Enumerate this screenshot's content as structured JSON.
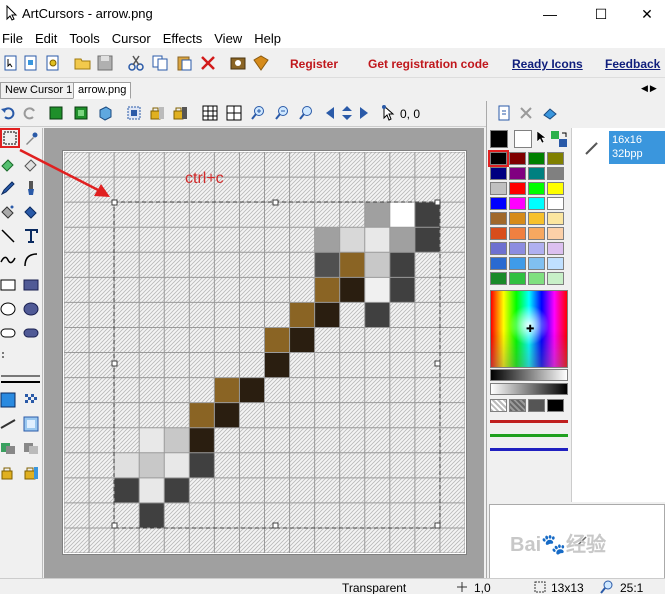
{
  "window": {
    "title": "ArtCursors - arrow.png"
  },
  "menu": [
    "File",
    "Edit",
    "Tools",
    "Cursor",
    "Effects",
    "View",
    "Help"
  ],
  "toolbar": {
    "register": "Register",
    "get_code": "Get registration code",
    "ready_icons": "Ready Icons",
    "feedback": "Feedback"
  },
  "tabs": [
    {
      "label": "New Cursor 1",
      "active": false
    },
    {
      "label": "arrow.png",
      "active": true
    }
  ],
  "coords": "0, 0",
  "annotation": "ctrl+c",
  "format_list": [
    {
      "line1": "16x16",
      "line2": "32bpp"
    }
  ],
  "palette": [
    "#000000",
    "#800000",
    "#008000",
    "#808000",
    "#000080",
    "#800080",
    "#008080",
    "#808080",
    "#c0c0c0",
    "#ff0000",
    "#00ff00",
    "#ffff00",
    "#0000ff",
    "#ff00ff",
    "#00ffff",
    "#ffffff",
    "#a0682b",
    "#d68b1a",
    "#f7c12c",
    "#fbe6a0",
    "#d84d1c",
    "#f08040",
    "#f7a860",
    "#fcd0a8",
    "#6e70d0",
    "#8c8ce0",
    "#b0b0f0",
    "#dcc0f0",
    "#2a6ad0",
    "#3f9be8",
    "#80c0f0",
    "#c0e0ff",
    "#1a8a2a",
    "#30c040",
    "#80e080",
    "#c8f0c8"
  ],
  "pixels": {
    "rows": 16,
    "cols": 16,
    "filled": [
      [
        2,
        12,
        "#a0a0a0"
      ],
      [
        2,
        13,
        "#ffffff"
      ],
      [
        2,
        14,
        "#404040"
      ],
      [
        3,
        10,
        "#a0a0a0"
      ],
      [
        3,
        11,
        "#d8d8d8"
      ],
      [
        3,
        12,
        "#e8e8e8"
      ],
      [
        3,
        13,
        "#a0a0a0"
      ],
      [
        3,
        14,
        "#404040"
      ],
      [
        4,
        10,
        "#505050"
      ],
      [
        4,
        11,
        "#8a6424"
      ],
      [
        4,
        12,
        "#c8c8c8"
      ],
      [
        4,
        13,
        "#404040"
      ],
      [
        5,
        10,
        "#8a6424"
      ],
      [
        5,
        11,
        "#2a1e10"
      ],
      [
        5,
        12,
        "#f0f0f0"
      ],
      [
        5,
        13,
        "#404040"
      ],
      [
        6,
        9,
        "#8a6424"
      ],
      [
        6,
        10,
        "#2a1e10"
      ],
      [
        6,
        12,
        "#404040"
      ],
      [
        7,
        8,
        "#8a6424"
      ],
      [
        7,
        9,
        "#2a1e10"
      ],
      [
        8,
        8,
        "#2a1e10"
      ],
      [
        9,
        6,
        "#8a6424"
      ],
      [
        9,
        7,
        "#2a1e10"
      ],
      [
        10,
        5,
        "#8a6424"
      ],
      [
        10,
        6,
        "#2a1e10"
      ],
      [
        11,
        3,
        "#e8e8e8"
      ],
      [
        11,
        4,
        "#c8c8c8"
      ],
      [
        11,
        5,
        "#2a1e10"
      ],
      [
        12,
        2,
        "#e0e0e0"
      ],
      [
        12,
        3,
        "#c8c8c8"
      ],
      [
        12,
        4,
        "#e8e8e8"
      ],
      [
        12,
        5,
        "#404040"
      ],
      [
        13,
        2,
        "#404040"
      ],
      [
        13,
        3,
        "#e8e8e8"
      ],
      [
        13,
        4,
        "#404040"
      ],
      [
        14,
        3,
        "#404040"
      ]
    ]
  },
  "status": {
    "transparent": "Transparent",
    "position": "1,0",
    "size": "13x13",
    "zoom": "25:1"
  },
  "colors": {
    "accent": "#3a96dd",
    "annotation": "#d22a2a"
  }
}
